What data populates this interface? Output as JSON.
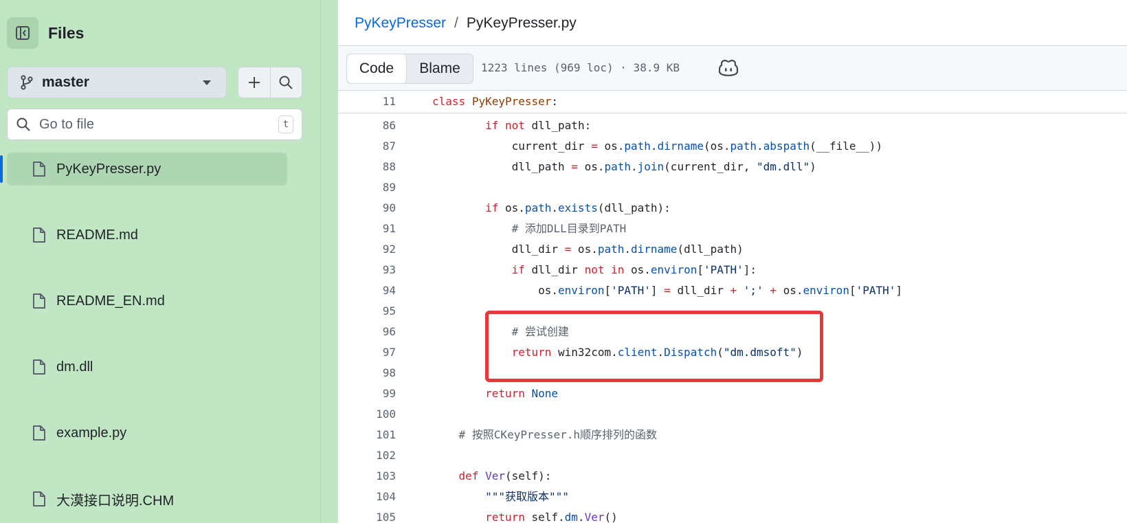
{
  "sidebar": {
    "title": "Files",
    "branch": "master",
    "search_placeholder": "Go to file",
    "search_shortcut": "t",
    "files": [
      {
        "name": "PyKeyPresser.py",
        "active": true
      },
      {
        "name": "README.md",
        "active": false
      },
      {
        "name": "README_EN.md",
        "active": false
      },
      {
        "name": "dm.dll",
        "active": false
      },
      {
        "name": "example.py",
        "active": false
      },
      {
        "name": "大漠接口说明.CHM",
        "active": false
      }
    ]
  },
  "header": {
    "repo": "PyKeyPresser",
    "separator": "/",
    "file": "PyKeyPresser.py"
  },
  "toolbar": {
    "code_tab": "Code",
    "blame_tab": "Blame",
    "file_meta": "1223 lines (969 loc) · 38.9 KB",
    "copilot_icon": "copilot-icon"
  },
  "code": {
    "sticky_line": {
      "number": "11",
      "tokens": [
        [
          "kw",
          "class"
        ],
        [
          "",
          " "
        ],
        [
          "cls",
          "PyKeyPresser"
        ],
        [
          "",
          ":"
        ]
      ]
    },
    "lines": [
      {
        "number": "86",
        "tokens": [
          [
            "",
            "        "
          ],
          [
            "kw",
            "if"
          ],
          [
            "",
            " "
          ],
          [
            "kw",
            "not"
          ],
          [
            "",
            " dll_path:"
          ]
        ]
      },
      {
        "number": "87",
        "tokens": [
          [
            "",
            "            current_dir "
          ],
          [
            "kw",
            "="
          ],
          [
            "",
            " os."
          ],
          [
            "nm",
            "path"
          ],
          [
            "",
            "."
          ],
          [
            "nm",
            "dirname"
          ],
          [
            "",
            "(os."
          ],
          [
            "nm",
            "path"
          ],
          [
            "",
            "."
          ],
          [
            "nm",
            "abspath"
          ],
          [
            "",
            "(__file__))"
          ]
        ]
      },
      {
        "number": "88",
        "tokens": [
          [
            "",
            "            dll_path "
          ],
          [
            "kw",
            "="
          ],
          [
            "",
            " os."
          ],
          [
            "nm",
            "path"
          ],
          [
            "",
            "."
          ],
          [
            "nm",
            "join"
          ],
          [
            "",
            "(current_dir, "
          ],
          [
            "st",
            "\"dm.dll\""
          ],
          [
            "",
            ")"
          ]
        ]
      },
      {
        "number": "89",
        "tokens": []
      },
      {
        "number": "90",
        "tokens": [
          [
            "",
            "        "
          ],
          [
            "kw",
            "if"
          ],
          [
            "",
            " os."
          ],
          [
            "nm",
            "path"
          ],
          [
            "",
            "."
          ],
          [
            "nm",
            "exists"
          ],
          [
            "",
            "(dll_path):"
          ]
        ]
      },
      {
        "number": "91",
        "tokens": [
          [
            "",
            "            "
          ],
          [
            "cm",
            "# 添加DLL目录到PATH"
          ]
        ]
      },
      {
        "number": "92",
        "tokens": [
          [
            "",
            "            dll_dir "
          ],
          [
            "kw",
            "="
          ],
          [
            "",
            " os."
          ],
          [
            "nm",
            "path"
          ],
          [
            "",
            "."
          ],
          [
            "nm",
            "dirname"
          ],
          [
            "",
            "(dll_path)"
          ]
        ]
      },
      {
        "number": "93",
        "tokens": [
          [
            "",
            "            "
          ],
          [
            "kw",
            "if"
          ],
          [
            "",
            " dll_dir "
          ],
          [
            "kw",
            "not"
          ],
          [
            "",
            " "
          ],
          [
            "kw",
            "in"
          ],
          [
            "",
            " os."
          ],
          [
            "nm",
            "environ"
          ],
          [
            "",
            "["
          ],
          [
            "st",
            "'PATH'"
          ],
          [
            "",
            "]:"
          ]
        ]
      },
      {
        "number": "94",
        "tokens": [
          [
            "",
            "                os."
          ],
          [
            "nm",
            "environ"
          ],
          [
            "",
            "["
          ],
          [
            "st",
            "'PATH'"
          ],
          [
            "",
            "] "
          ],
          [
            "kw",
            "="
          ],
          [
            "",
            " dll_dir "
          ],
          [
            "kw",
            "+"
          ],
          [
            "",
            " "
          ],
          [
            "st",
            "';'"
          ],
          [
            "",
            " "
          ],
          [
            "kw",
            "+"
          ],
          [
            "",
            " os."
          ],
          [
            "nm",
            "environ"
          ],
          [
            "",
            "["
          ],
          [
            "st",
            "'PATH'"
          ],
          [
            "",
            "]"
          ]
        ]
      },
      {
        "number": "95",
        "tokens": []
      },
      {
        "number": "96",
        "tokens": [
          [
            "",
            "            "
          ],
          [
            "cm",
            "# 尝试创建"
          ]
        ]
      },
      {
        "number": "97",
        "tokens": [
          [
            "",
            "            "
          ],
          [
            "kw",
            "return"
          ],
          [
            "",
            " win32com."
          ],
          [
            "nm",
            "client"
          ],
          [
            "",
            "."
          ],
          [
            "nm",
            "Dispatch"
          ],
          [
            "",
            "("
          ],
          [
            "st",
            "\"dm.dmsoft\""
          ],
          [
            "",
            ")"
          ]
        ]
      },
      {
        "number": "98",
        "tokens": []
      },
      {
        "number": "99",
        "tokens": [
          [
            "",
            "        "
          ],
          [
            "kw",
            "return"
          ],
          [
            "",
            " "
          ],
          [
            "nm",
            "None"
          ]
        ]
      },
      {
        "number": "100",
        "tokens": []
      },
      {
        "number": "101",
        "tokens": [
          [
            "",
            "    "
          ],
          [
            "cm",
            "# 按照CKeyPresser.h顺序排列的函数"
          ]
        ]
      },
      {
        "number": "102",
        "tokens": []
      },
      {
        "number": "103",
        "tokens": [
          [
            "",
            "    "
          ],
          [
            "kw",
            "def"
          ],
          [
            "",
            " "
          ],
          [
            "fn",
            "Ver"
          ],
          [
            "",
            "(self):"
          ]
        ]
      },
      {
        "number": "104",
        "tokens": [
          [
            "",
            "        "
          ],
          [
            "st",
            "\"\"\"获取版本\"\"\""
          ]
        ]
      },
      {
        "number": "105",
        "tokens": [
          [
            "",
            "        "
          ],
          [
            "kw",
            "return"
          ],
          [
            "",
            " self."
          ],
          [
            "nm",
            "dm"
          ],
          [
            "",
            "."
          ],
          [
            "fn",
            "Ver"
          ],
          [
            "",
            "()"
          ]
        ]
      }
    ]
  },
  "colors": {
    "sidebar_bg": "#c0e6c4",
    "link": "#0969da",
    "highlight_box": "#e8373a"
  }
}
